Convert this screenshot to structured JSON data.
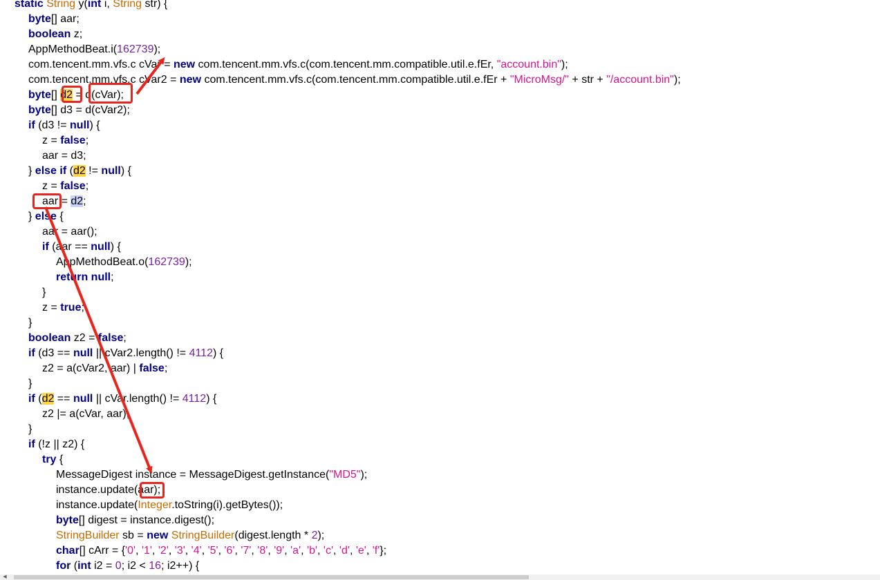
{
  "colors": {
    "keyword": "#000080",
    "type": "#c76b00",
    "number": "#7a1fa2",
    "string": "#d4148f",
    "highlight_yellow": "#ffd34a",
    "highlight_blue": "#c9d2f7",
    "annotation_red": "#e8251d"
  },
  "scrollbar": {
    "left_arrow_icon": "chevron-left-icon"
  },
  "code_lines": [
    {
      "indent": 0,
      "tokens": [
        [
          "kw",
          "static"
        ],
        [
          "p",
          " "
        ],
        [
          "type",
          "String"
        ],
        [
          "p",
          " y("
        ],
        [
          "kw",
          "int"
        ],
        [
          "p",
          " i, "
        ],
        [
          "type",
          "String"
        ],
        [
          "p",
          " str) {"
        ]
      ]
    },
    {
      "indent": 1,
      "tokens": [
        [
          "kw",
          "byte"
        ],
        [
          "p",
          "[] aar;"
        ]
      ]
    },
    {
      "indent": 1,
      "tokens": [
        [
          "kw",
          "boolean"
        ],
        [
          "p",
          " z;"
        ]
      ]
    },
    {
      "indent": 1,
      "tokens": [
        [
          "p",
          "AppMethodBeat.i("
        ],
        [
          "num",
          "162739"
        ],
        [
          "p",
          ");"
        ]
      ]
    },
    {
      "indent": 1,
      "tokens": [
        [
          "p",
          "com.tencent.mm.vfs.c cVar = "
        ],
        [
          "kw",
          "new"
        ],
        [
          "p",
          " com.tencent.mm.vfs.c(com.tencent.mm.compatible.util.e.fEr, "
        ],
        [
          "str",
          "\"account.bin\""
        ],
        [
          "p",
          ");"
        ]
      ]
    },
    {
      "indent": 1,
      "tokens": [
        [
          "p",
          "com.tencent.mm.vfs.c cVar2 = "
        ],
        [
          "kw",
          "new"
        ],
        [
          "p",
          " com.tencent.mm.vfs.c(com.tencent.mm.compatible.util.e.fEr + "
        ],
        [
          "str",
          "\"MicroMsg/\""
        ],
        [
          "p",
          " + str + "
        ],
        [
          "str",
          "\"/account.bin\""
        ],
        [
          "p",
          ");"
        ]
      ]
    },
    {
      "indent": 1,
      "tokens": [
        [
          "kw",
          "byte"
        ],
        [
          "p",
          "[] "
        ],
        [
          "hly",
          "d2"
        ],
        [
          "p",
          " = d(cVar);"
        ]
      ]
    },
    {
      "indent": 1,
      "tokens": [
        [
          "kw",
          "byte"
        ],
        [
          "p",
          "[] d3 = d(cVar2);"
        ]
      ]
    },
    {
      "indent": 1,
      "tokens": [
        [
          "kw",
          "if"
        ],
        [
          "p",
          " (d3 != "
        ],
        [
          "kw",
          "null"
        ],
        [
          "p",
          ") {"
        ]
      ]
    },
    {
      "indent": 2,
      "tokens": [
        [
          "p",
          "z = "
        ],
        [
          "kw",
          "false"
        ],
        [
          "p",
          ";"
        ]
      ]
    },
    {
      "indent": 2,
      "tokens": [
        [
          "p",
          "aar = d3;"
        ]
      ]
    },
    {
      "indent": 1,
      "tokens": [
        [
          "p",
          "} "
        ],
        [
          "kw",
          "else if"
        ],
        [
          "p",
          " ("
        ],
        [
          "hly",
          "d2"
        ],
        [
          "p",
          " != "
        ],
        [
          "kw",
          "null"
        ],
        [
          "p",
          ") {"
        ]
      ]
    },
    {
      "indent": 2,
      "tokens": [
        [
          "p",
          "z = "
        ],
        [
          "kw",
          "false"
        ],
        [
          "p",
          ";"
        ]
      ]
    },
    {
      "indent": 2,
      "tokens": [
        [
          "p",
          "aar = "
        ],
        [
          "hlb",
          "d2"
        ],
        [
          "p",
          ";"
        ]
      ]
    },
    {
      "indent": 1,
      "tokens": [
        [
          "p",
          "} "
        ],
        [
          "kw",
          "else"
        ],
        [
          "p",
          " {"
        ]
      ]
    },
    {
      "indent": 2,
      "tokens": [
        [
          "p",
          "aar = aar();"
        ]
      ]
    },
    {
      "indent": 2,
      "tokens": [
        [
          "kw",
          "if"
        ],
        [
          "p",
          " (aar == "
        ],
        [
          "kw",
          "null"
        ],
        [
          "p",
          ") {"
        ]
      ]
    },
    {
      "indent": 3,
      "tokens": [
        [
          "p",
          "AppMethodBeat.o("
        ],
        [
          "num",
          "162739"
        ],
        [
          "p",
          ");"
        ]
      ]
    },
    {
      "indent": 3,
      "tokens": [
        [
          "kw",
          "return null"
        ],
        [
          "p",
          ";"
        ]
      ]
    },
    {
      "indent": 2,
      "tokens": [
        [
          "p",
          "}"
        ]
      ]
    },
    {
      "indent": 2,
      "tokens": [
        [
          "p",
          "z = "
        ],
        [
          "kw",
          "true"
        ],
        [
          "p",
          ";"
        ]
      ]
    },
    {
      "indent": 1,
      "tokens": [
        [
          "p",
          "}"
        ]
      ]
    },
    {
      "indent": 1,
      "tokens": [
        [
          "kw",
          "boolean"
        ],
        [
          "p",
          " z2 = "
        ],
        [
          "kw",
          "false"
        ],
        [
          "p",
          ";"
        ]
      ]
    },
    {
      "indent": 1,
      "tokens": [
        [
          "kw",
          "if"
        ],
        [
          "p",
          " (d3 == "
        ],
        [
          "kw",
          "null"
        ],
        [
          "p",
          " || cVar2.length() != "
        ],
        [
          "num",
          "4112"
        ],
        [
          "p",
          ") {"
        ]
      ]
    },
    {
      "indent": 2,
      "tokens": [
        [
          "p",
          "z2 = a(cVar2, aar) | "
        ],
        [
          "kw",
          "false"
        ],
        [
          "p",
          ";"
        ]
      ]
    },
    {
      "indent": 1,
      "tokens": [
        [
          "p",
          "}"
        ]
      ]
    },
    {
      "indent": 1,
      "tokens": [
        [
          "kw",
          "if"
        ],
        [
          "p",
          " ("
        ],
        [
          "hly",
          "d2"
        ],
        [
          "p",
          " == "
        ],
        [
          "kw",
          "null"
        ],
        [
          "p",
          " || cVar.length() != "
        ],
        [
          "num",
          "4112"
        ],
        [
          "p",
          ") {"
        ]
      ]
    },
    {
      "indent": 2,
      "tokens": [
        [
          "p",
          "z2 |= a(cVar, aar);"
        ]
      ]
    },
    {
      "indent": 1,
      "tokens": [
        [
          "p",
          "}"
        ]
      ]
    },
    {
      "indent": 1,
      "tokens": [
        [
          "kw",
          "if"
        ],
        [
          "p",
          " (!z || z2) {"
        ]
      ]
    },
    {
      "indent": 2,
      "tokens": [
        [
          "kw",
          "try"
        ],
        [
          "p",
          " {"
        ]
      ]
    },
    {
      "indent": 3,
      "tokens": [
        [
          "p",
          "MessageDigest instance = MessageDigest.getInstance("
        ],
        [
          "str",
          "\"MD5\""
        ],
        [
          "p",
          ");"
        ]
      ]
    },
    {
      "indent": 3,
      "tokens": [
        [
          "p",
          "instance.update(aar);"
        ]
      ]
    },
    {
      "indent": 3,
      "tokens": [
        [
          "p",
          "instance.update("
        ],
        [
          "type",
          "Integer"
        ],
        [
          "p",
          ".toString(i).getBytes());"
        ]
      ]
    },
    {
      "indent": 3,
      "tokens": [
        [
          "kw",
          "byte"
        ],
        [
          "p",
          "[] digest = instance.digest();"
        ]
      ]
    },
    {
      "indent": 3,
      "tokens": [
        [
          "type",
          "StringBuilder"
        ],
        [
          "p",
          " sb = "
        ],
        [
          "kw",
          "new"
        ],
        [
          "p",
          " "
        ],
        [
          "type",
          "StringBuilder"
        ],
        [
          "p",
          "(digest.length * "
        ],
        [
          "num",
          "2"
        ],
        [
          "p",
          ");"
        ]
      ]
    },
    {
      "indent": 3,
      "tokens": [
        [
          "kw",
          "char"
        ],
        [
          "p",
          "[] cArr = {"
        ],
        [
          "str",
          "'0'"
        ],
        [
          "p",
          ", "
        ],
        [
          "str",
          "'1'"
        ],
        [
          "p",
          ", "
        ],
        [
          "str",
          "'2'"
        ],
        [
          "p",
          ", "
        ],
        [
          "str",
          "'3'"
        ],
        [
          "p",
          ", "
        ],
        [
          "str",
          "'4'"
        ],
        [
          "p",
          ", "
        ],
        [
          "str",
          "'5'"
        ],
        [
          "p",
          ", "
        ],
        [
          "str",
          "'6'"
        ],
        [
          "p",
          ", "
        ],
        [
          "str",
          "'7'"
        ],
        [
          "p",
          ", "
        ],
        [
          "str",
          "'8'"
        ],
        [
          "p",
          ", "
        ],
        [
          "str",
          "'9'"
        ],
        [
          "p",
          ", "
        ],
        [
          "str",
          "'a'"
        ],
        [
          "p",
          ", "
        ],
        [
          "str",
          "'b'"
        ],
        [
          "p",
          ", "
        ],
        [
          "str",
          "'c'"
        ],
        [
          "p",
          ", "
        ],
        [
          "str",
          "'d'"
        ],
        [
          "p",
          ", "
        ],
        [
          "str",
          "'e'"
        ],
        [
          "p",
          ", "
        ],
        [
          "str",
          "'f'"
        ],
        [
          "p",
          "};"
        ]
      ]
    },
    {
      "indent": 3,
      "tokens": [
        [
          "kw",
          "for"
        ],
        [
          "p",
          " ("
        ],
        [
          "kw",
          "int"
        ],
        [
          "p",
          " i2 = "
        ],
        [
          "num",
          "0"
        ],
        [
          "p",
          "; i2 < "
        ],
        [
          "num",
          "16"
        ],
        [
          "p",
          "; i2++) {"
        ]
      ]
    }
  ]
}
